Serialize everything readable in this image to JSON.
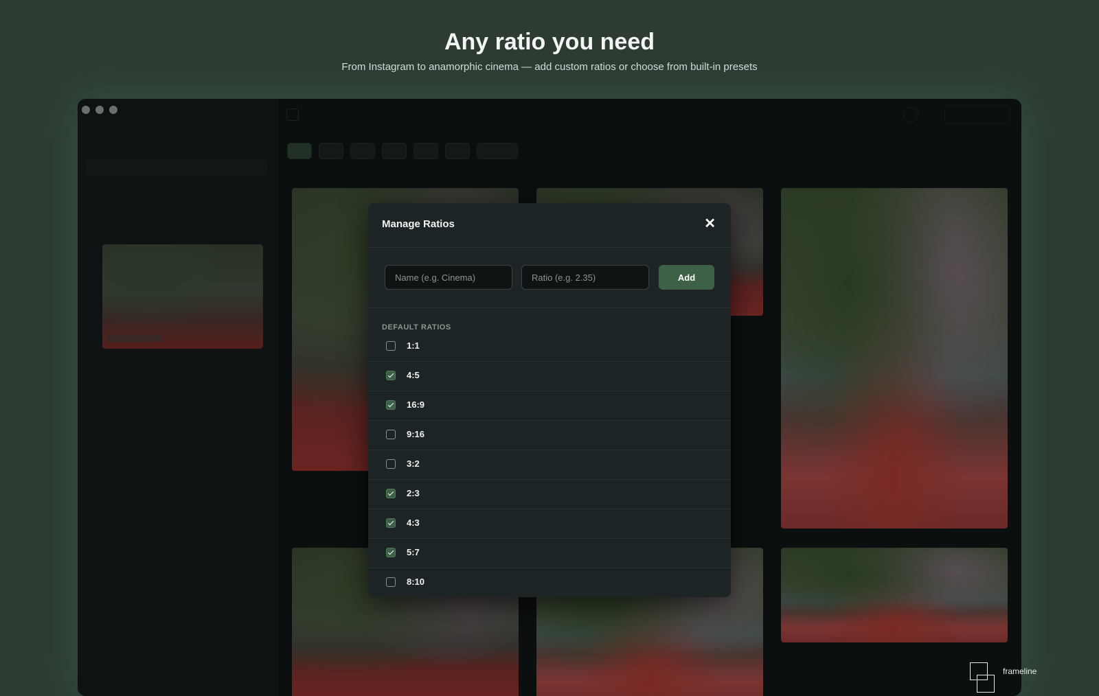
{
  "hero": {
    "title": "Any ratio you need",
    "subtitle": "From Instagram to anamorphic cinema — add custom ratios or choose from built-in presets"
  },
  "modal": {
    "title": "Manage Ratios",
    "close_icon": "close-icon",
    "name_placeholder": "Name (e.g. Cinema)",
    "ratio_placeholder": "Ratio (e.g. 2.35)",
    "add_label": "Add",
    "section_label": "DEFAULT RATIOS",
    "ratios": [
      {
        "label": "1:1",
        "checked": false
      },
      {
        "label": "4:5",
        "checked": true
      },
      {
        "label": "16:9",
        "checked": true
      },
      {
        "label": "9:16",
        "checked": false
      },
      {
        "label": "3:2",
        "checked": false
      },
      {
        "label": "2:3",
        "checked": true
      },
      {
        "label": "4:3",
        "checked": true
      },
      {
        "label": "5:7",
        "checked": true
      },
      {
        "label": "8:10",
        "checked": false
      }
    ]
  },
  "brand": {
    "name": "frameline"
  },
  "colors": {
    "background": "#2d3b33",
    "accent": "#3d6047",
    "modal": "#1d2426"
  }
}
